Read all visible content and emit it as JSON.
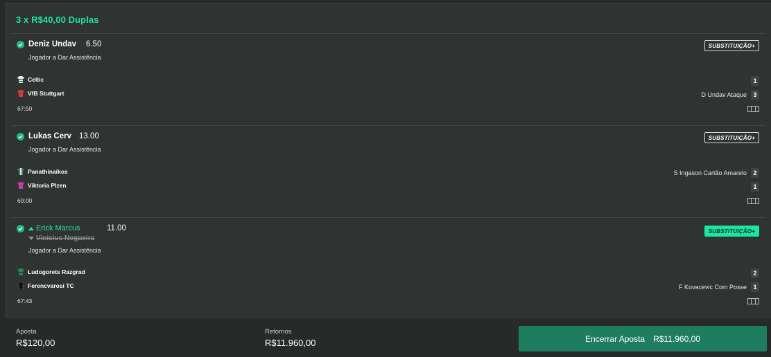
{
  "header": {
    "title": "3 x R$40,00 Duplas"
  },
  "selections": [
    {
      "player": "Deniz Undav",
      "odds": "6.50",
      "market": "Jogador a Dar Assistência",
      "substitution_label": "SUBSTITUIÇÃO+",
      "teams": [
        {
          "name": "Celtic",
          "score": "1",
          "event": "",
          "jersey_color": "#e8e8e8"
        },
        {
          "name": "VfB Stuttgart",
          "score": "3",
          "event": "D Undav Ataque",
          "jersey_color": "#d43a3a"
        }
      ],
      "clock": "67:50"
    },
    {
      "player": "Lukas Cerv",
      "odds": "13.00",
      "market": "Jogador a Dar Assistência",
      "substitution_label": "SUBSTITUIÇÃO+",
      "teams": [
        {
          "name": "Panathinaikos",
          "score": "2",
          "event": "S Ingason Cartão Amarelo",
          "jersey_color": "#2d8c5a"
        },
        {
          "name": "Viktoria Plzen",
          "score": "1",
          "event": "",
          "jersey_color": "#c23aa8"
        }
      ],
      "clock": "69:00"
    },
    {
      "player_in": "Erick Marcus",
      "player_out": "Vinicius Nogueira",
      "odds": "11.00",
      "market": "Jogador a Dar Assistência",
      "substitution_label": "SUBSTITUIÇÃO+",
      "teams": [
        {
          "name": "Ludogorets Razgrad",
          "score": "2",
          "event": "",
          "jersey_color": "#1f8a4c"
        },
        {
          "name": "Ferencvarosi TC",
          "score": "1",
          "event": "F Kovacevic Com Posse",
          "jersey_color": "#101010"
        }
      ],
      "clock": "67:43"
    }
  ],
  "footer": {
    "stake_label": "Aposta",
    "stake_value": "R$120,00",
    "returns_label": "Retornos",
    "returns_value": "R$11.960,00",
    "cashout_label": "Encerrar Aposta",
    "cashout_value": "R$11.960,00"
  },
  "colors": {
    "accent": "#1ee4a1",
    "cashout_bg": "#1e7d5f",
    "background": "#2f3331"
  },
  "icons": [
    "check-circle-icon",
    "jersey-icon",
    "pitch-icon",
    "arrow-up-icon",
    "arrow-down-icon"
  ]
}
